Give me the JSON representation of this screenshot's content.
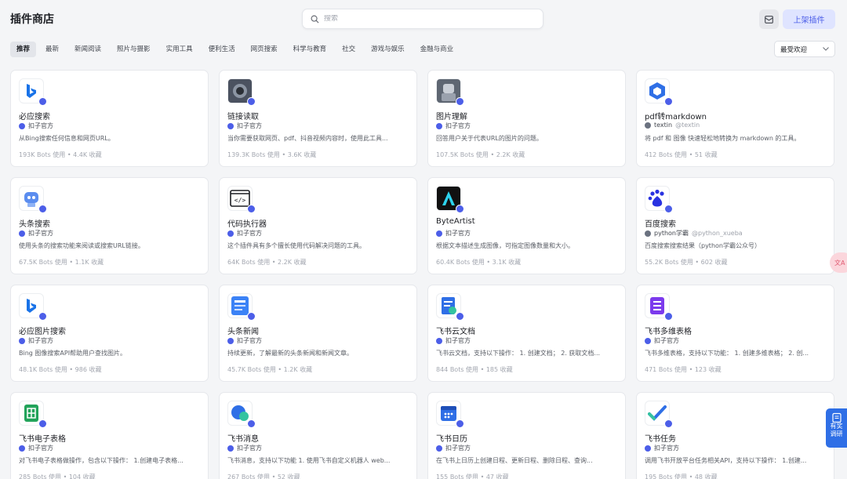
{
  "header": {
    "title": "插件商店",
    "search_placeholder": "搜索",
    "publish_label": "上架插件"
  },
  "tabs": [
    "推荐",
    "最新",
    "新闻阅读",
    "照片与摄影",
    "实用工具",
    "便利生活",
    "网页搜索",
    "科学与教育",
    "社交",
    "游戏与娱乐",
    "金融与商业"
  ],
  "active_tab": "推荐",
  "sort": {
    "selected": "最受欢迎"
  },
  "floating": {
    "translate_label": "文A",
    "survey_label_1": "有奖",
    "survey_label_2": "调研"
  },
  "plugins": [
    {
      "name": "必应搜索",
      "author": "扣子官方",
      "handle": "",
      "desc": "从Bing搜索任何信息和网页URL。",
      "stats": "193K Bots 使用 • 4.4K 收藏",
      "icon": "bing-icon",
      "color": "#1a73e8"
    },
    {
      "name": "链接读取",
      "author": "扣子官方",
      "handle": "",
      "desc": "当你需要获取网页、pdf、抖音视频内容时，使用此工具...",
      "stats": "139.3K Bots 使用 • 3.6K 收藏",
      "icon": "photo-icon",
      "color": "#555b66"
    },
    {
      "name": "图片理解",
      "author": "扣子官方",
      "handle": "",
      "desc": "回答用户关于代表URL的图片的问题。",
      "stats": "107.5K Bots 使用 • 2.2K 收藏",
      "icon": "robot-photo-icon",
      "color": "#6b7280"
    },
    {
      "name": "pdf转markdown",
      "author": "textin",
      "handle": "@textin",
      "desc": "将 pdf 和 图像 快速轻松地转换为 markdown 的工具。",
      "stats": "412 Bots 使用 • 51 收藏",
      "icon": "cube-icon",
      "color": "#2f6fe6"
    },
    {
      "name": "头条搜索",
      "author": "扣子官方",
      "handle": "",
      "desc": "使用头条的搜索功能来阅读或搜索URL链接。",
      "stats": "67.5K Bots 使用 • 1.1K 收藏",
      "icon": "robot-icon",
      "color": "#5b8def"
    },
    {
      "name": "代码执行器",
      "author": "扣子官方",
      "handle": "",
      "desc": "这个插件具有多个擅长使用代码解决问题的工具。",
      "stats": "64K Bots 使用 • 2.2K 收藏",
      "icon": "code-icon",
      "color": "#1d1f24"
    },
    {
      "name": "ByteArtist",
      "author": "扣子官方",
      "handle": "",
      "desc": "根据文本描述生成图像，可指定图像数量和大小。",
      "stats": "60.4K Bots 使用 • 3.1K 收藏",
      "icon": "byteartist-icon",
      "color": "#111111"
    },
    {
      "name": "百度搜索",
      "author": "python学霸",
      "handle": "@python_xueba",
      "desc": "百度搜索搜索结果（python学霸公众号）",
      "stats": "55.2K Bots 使用 • 602 收藏",
      "icon": "baidu-icon",
      "color": "#2932e1"
    },
    {
      "name": "必应图片搜索",
      "author": "扣子官方",
      "handle": "",
      "desc": "Bing 图像搜索API帮助用户查找图片。",
      "stats": "48.1K Bots 使用 • 986 收藏",
      "icon": "bing-icon",
      "color": "#1a73e8"
    },
    {
      "name": "头条新闻",
      "author": "扣子官方",
      "handle": "",
      "desc": "持续更新，了解最新的头条新闻和新闻文章。",
      "stats": "45.7K Bots 使用 • 1.2K 收藏",
      "icon": "news-icon",
      "color": "#3b82f6"
    },
    {
      "name": "飞书云文档",
      "author": "扣子官方",
      "handle": "",
      "desc": "飞书云文档，支持以下操作： 1. 创建文档； 2. 获取文档...",
      "stats": "844 Bots 使用 • 185 收藏",
      "icon": "doc-icon",
      "color": "#2f6fe6"
    },
    {
      "name": "飞书多维表格",
      "author": "扣子官方",
      "handle": "",
      "desc": "飞书多维表格，支持以下功能： 1. 创建多维表格； 2. 创...",
      "stats": "471 Bots 使用 • 123 收藏",
      "icon": "bitable-icon",
      "color": "#7c3aed"
    },
    {
      "name": "飞书电子表格",
      "author": "扣子官方",
      "handle": "",
      "desc": "对飞书电子表格做操作，包含以下操作： 1.创建电子表格...",
      "stats": "285 Bots 使用 • 104 收藏",
      "icon": "sheet-icon",
      "color": "#22a35a"
    },
    {
      "name": "飞书消息",
      "author": "扣子官方",
      "handle": "",
      "desc": "飞书消息，支持以下功能 1. 使用飞书自定义机器人 web...",
      "stats": "267 Bots 使用 • 52 收藏",
      "icon": "message-icon",
      "color": "#2f6fe6"
    },
    {
      "name": "飞书日历",
      "author": "扣子官方",
      "handle": "",
      "desc": "在飞书上日历上创建日程、更新日程、删除日程、查询...",
      "stats": "155 Bots 使用 • 47 收藏",
      "icon": "calendar-icon",
      "color": "#2f6fe6"
    },
    {
      "name": "飞书任务",
      "author": "扣子官方",
      "handle": "",
      "desc": "调用飞书开放平台任务相关API，支持以下操作： 1.创建...",
      "stats": "195 Bots 使用 • 48 收藏",
      "icon": "task-icon",
      "color": "#2f6fe6"
    }
  ]
}
